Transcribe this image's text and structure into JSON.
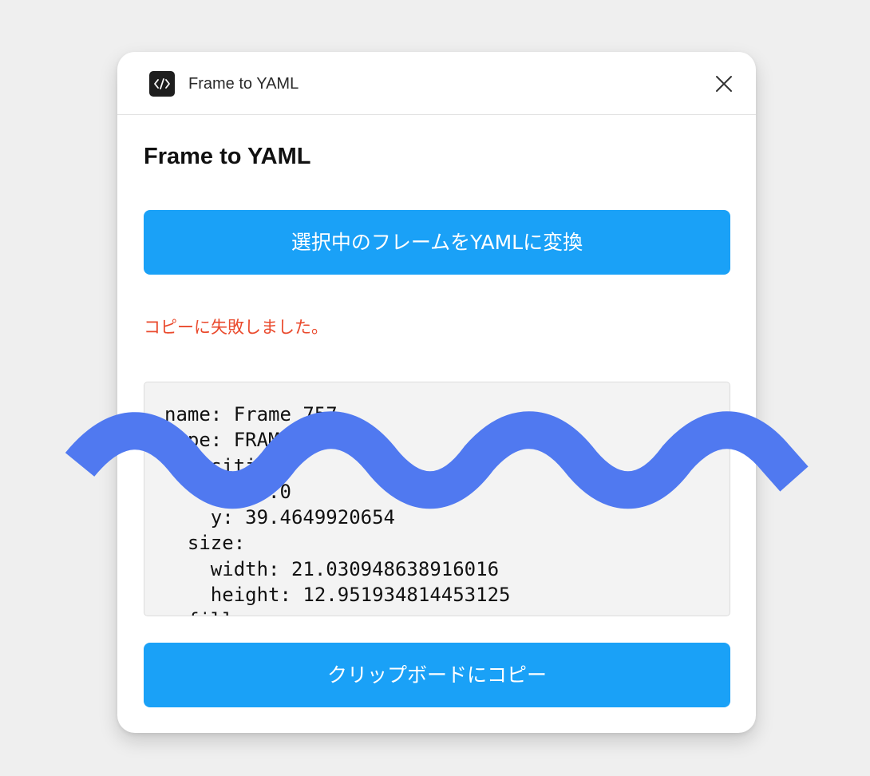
{
  "window": {
    "title": "Frame to YAML",
    "icon": "code-icon",
    "close_icon": "close-icon"
  },
  "content": {
    "heading": "Frame to YAML",
    "convert_button_label": "選択中のフレームをYAMLに変換",
    "error_message": "コピーに失敗しました。",
    "yaml_text": "name: Frame 757\ntype: FRAME\n  position:\n    x: 39.0\n    y: 39.4649920654\n  size:\n    width: 21.030948638916016\n    height: 12.951934814453125\n  fills:\n    - type: SOLID",
    "copy_button_label": "クリップボードにコピー"
  },
  "colors": {
    "accent_button": "#1aa1f7",
    "error_text": "#ea4a2d",
    "wave_overlay": "#5079f0",
    "background": "#efefef"
  }
}
